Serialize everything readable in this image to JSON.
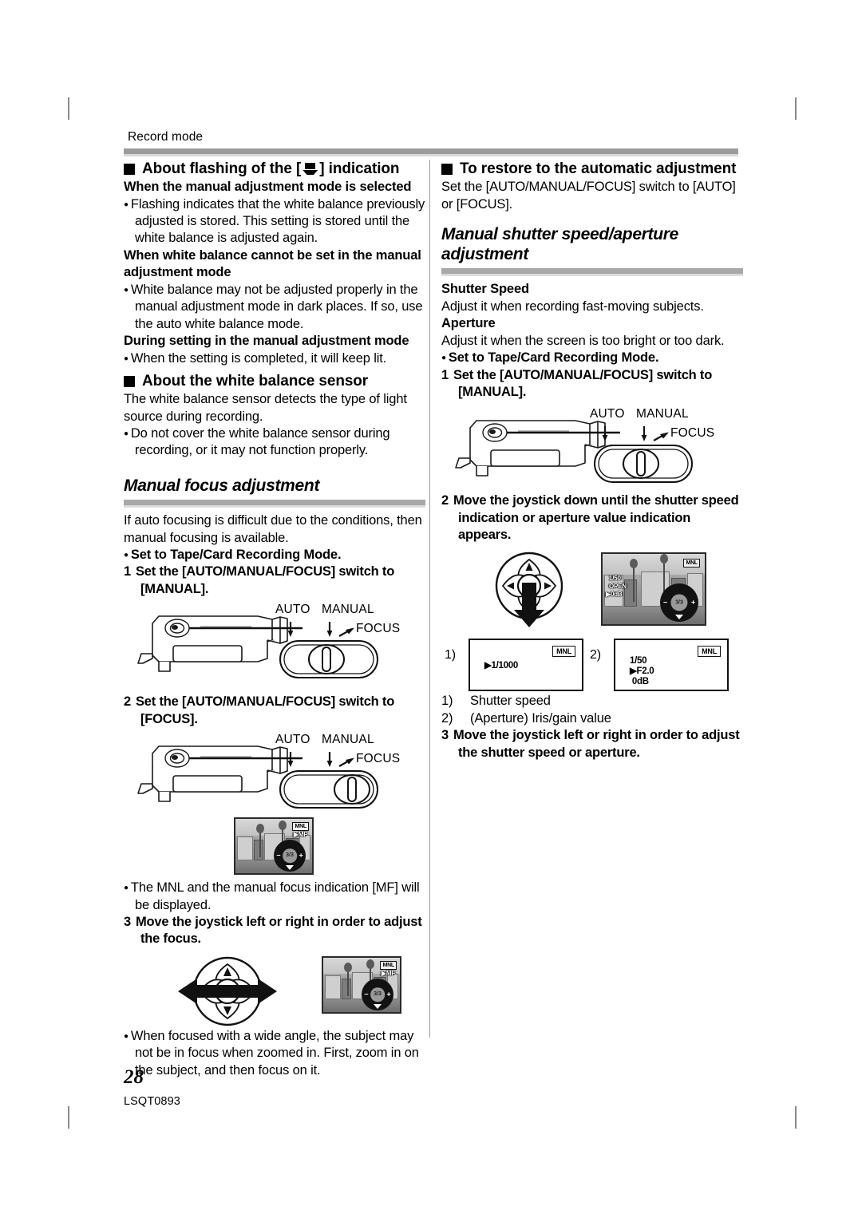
{
  "page": {
    "header": "Record mode",
    "number": "28",
    "code": "LSQT0893"
  },
  "left_column": {
    "heading_flash": {
      "text_before": "About flashing of the [",
      "icon": "white-balance-icon",
      "text_after": "] indication"
    },
    "sub1": "When the manual adjustment mode is selected",
    "bullet1": "Flashing indicates that the white balance previously adjusted is stored. This setting is stored until the white balance is adjusted again.",
    "sub2": "When white balance cannot be set in the manual adjustment mode",
    "bullet2": "White balance may not be adjusted properly in the manual adjustment mode in dark places. If so, use the auto white balance mode.",
    "sub3": "During setting in the manual adjustment mode",
    "bullet3": "When the setting is completed, it will keep lit.",
    "heading_sensor": "About the white balance sensor",
    "sensor_body": "The white balance sensor detects the type of light source during recording.",
    "sensor_bullet": "Do not cover the white balance sensor during recording, or it may not function properly.",
    "section_title": "Manual focus adjustment",
    "intro": "If auto focusing is difficult due to the conditions, then manual focusing is available.",
    "bullet_set_mode": "Set to Tape/Card Recording Mode.",
    "step1_num": "1",
    "step1": "Set the [AUTO/MANUAL/FOCUS] switch to [MANUAL].",
    "switch_labels": {
      "auto": "AUTO",
      "manual": "MANUAL",
      "focus": "FOCUS"
    },
    "step2_num": "2",
    "step2": "Set the [AUTO/MANUAL/FOCUS] switch to [FOCUS].",
    "lcd_osd": {
      "mnl": "MNL",
      "mf": "MF",
      "joy": "3/3"
    },
    "bullet_mnl": "The MNL and the manual focus indication [MF] will be displayed.",
    "step3_num": "3",
    "step3": "Move the joystick left or right in order to adjust the focus.",
    "bullet_wide": "When focused with a wide angle, the subject may not be in focus when zoomed in. First, zoom in on the subject, and then focus on it."
  },
  "right_column": {
    "heading_restore": "To restore to the automatic adjustment",
    "restore_body": "Set the [AUTO/MANUAL/FOCUS] switch to [AUTO] or [FOCUS].",
    "section_title": "Manual shutter speed/aperture adjustment",
    "shutter_label": "Shutter Speed",
    "shutter_body": "Adjust it when recording fast-moving subjects.",
    "aperture_label": "Aperture",
    "aperture_body": "Adjust it when the screen is too bright or too dark.",
    "bullet_set_mode": "Set to Tape/Card Recording Mode.",
    "step1_num": "1",
    "step1": "Set the [AUTO/MANUAL/FOCUS] switch to [MANUAL].",
    "switch_labels": {
      "auto": "AUTO",
      "manual": "MANUAL",
      "focus": "FOCUS"
    },
    "step2_num": "2",
    "step2": "Move the joystick down until the shutter speed indication or aperture value indication appears.",
    "lcd_osd": {
      "mnl": "MNL",
      "line1": "1/50",
      "line2": "OPEN",
      "line3": "▶0dB",
      "joy": "3/3"
    },
    "monitors": [
      {
        "label": "1)",
        "mnl": "MNL",
        "value": "▶1/1000"
      },
      {
        "label": "2)",
        "mnl": "MNL",
        "value": "1/50\n▶F2.0\n 0dB"
      }
    ],
    "legend1": {
      "n": "1)",
      "text": "Shutter speed"
    },
    "legend2": {
      "n": "2)",
      "text": "(Aperture) Iris/gain value"
    },
    "step3_num": "3",
    "step3": "Move the joystick left or right in order to adjust the shutter speed or aperture."
  },
  "colors": {
    "rule_gray": "#9c9c9c",
    "rule_light": "#d8d8d8",
    "divider": "#9a9a9a"
  }
}
